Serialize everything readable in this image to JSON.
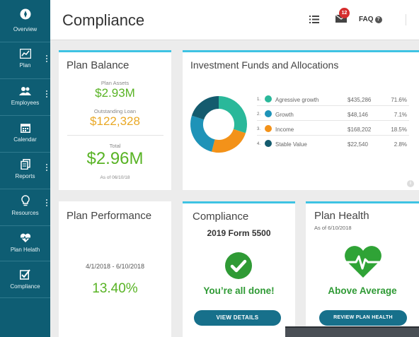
{
  "colors": {
    "sidebar": "#0e5d73",
    "accent": "#3ec3e3",
    "green": "#58b324",
    "gold": "#e9a825",
    "button": "#17708b",
    "badge": "#d62e2e"
  },
  "sidebar": {
    "items": [
      {
        "label": "Overview",
        "icon": "compass-icon"
      },
      {
        "label": "Plan",
        "icon": "line-chart-icon"
      },
      {
        "label": "Employees",
        "icon": "people-icon"
      },
      {
        "label": "Calendar",
        "icon": "calendar-icon"
      },
      {
        "label": "Reports",
        "icon": "documents-icon"
      },
      {
        "label": "Resources",
        "icon": "lightbulb-icon"
      },
      {
        "label": "Plan Helath",
        "icon": "heart-pulse-icon"
      },
      {
        "label": "Compliance",
        "icon": "checkbox-icon"
      }
    ]
  },
  "header": {
    "title": "Compliance",
    "notifications": "12",
    "faq": "FAQ",
    "faq_icon": "?"
  },
  "plan_balance": {
    "title": "Plan Balance",
    "assets_label": "Plan Assets",
    "assets_value": "$2.93M",
    "loan_label": "Outstanding Loan",
    "loan_value": "$122,328",
    "total_label": "Total",
    "total_value": "$2.96M",
    "as_of": "As of 06/10/18"
  },
  "funds": {
    "title": "Investment Funds and Allocations",
    "rows": [
      {
        "num": "1.",
        "name": "Agressive growth",
        "amount": "$435,286",
        "pct": "71.6%",
        "color": "#2ab89a"
      },
      {
        "num": "2.",
        "name": "Growth",
        "amount": "$48,146",
        "pct": "7.1%",
        "color": "#1e93b8"
      },
      {
        "num": "3.",
        "name": "Income",
        "amount": "$168,202",
        "pct": "18.5%",
        "color": "#f39219"
      },
      {
        "num": "4.",
        "name": "Stable Value",
        "amount": "$22,540",
        "pct": "2.8%",
        "color": "#145b6e"
      }
    ],
    "info_icon": "i"
  },
  "performance": {
    "title": "Plan Performance",
    "range": "4/1/2018 - 6/10/2018",
    "value": "13.40%"
  },
  "compliance": {
    "title": "Compliance",
    "subtitle": "2019 Form 5500",
    "message": "You’re all done!",
    "button": "VIEW DETAILS"
  },
  "health": {
    "title": "Plan Health",
    "as_of": "As of 6/10/2018",
    "status": "Above Average",
    "button": "REVIEW PLAN HEALTH"
  }
}
